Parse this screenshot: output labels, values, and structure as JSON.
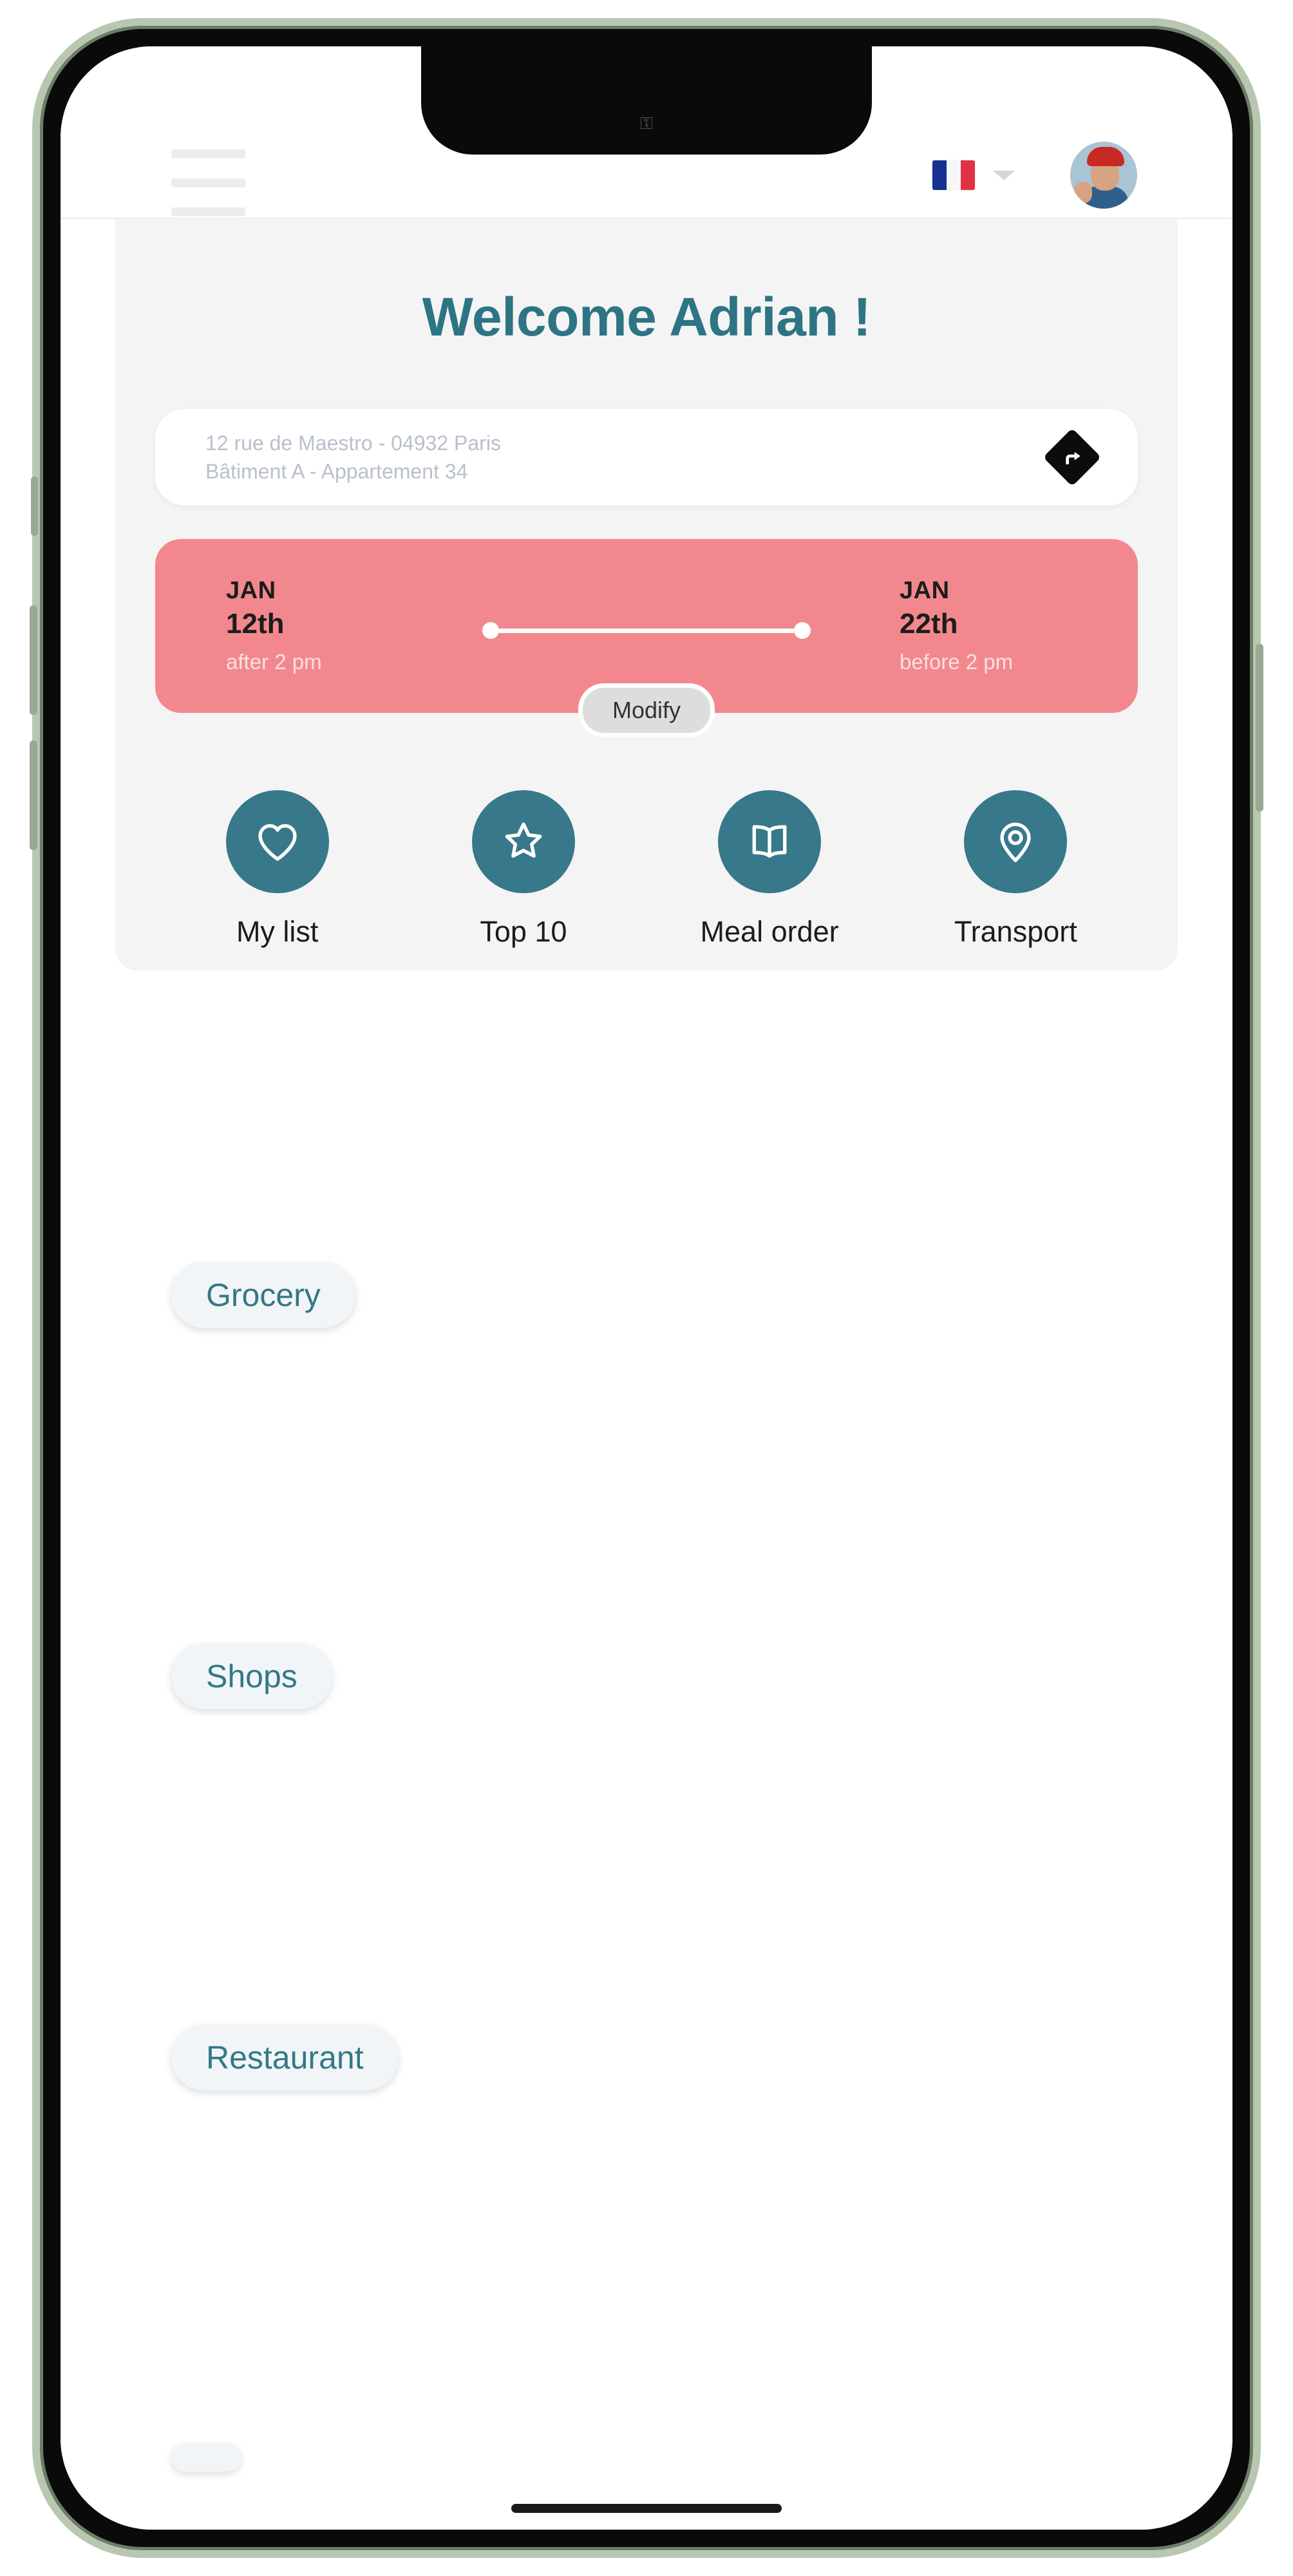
{
  "app": {
    "header": {
      "menu_icon": "hamburger-menu-icon",
      "language_flag": "france-flag-icon",
      "language_code": "FR",
      "chevron_icon": "chevron-down-icon",
      "avatar_icon": "user-avatar"
    },
    "status_bar": {
      "lock_icon": "lock-icon",
      "lock_glyph": "⚿"
    },
    "welcome_title": "Welcome Adrian !",
    "address": {
      "line1": "12 rue de Maestro - 04932 Paris",
      "line2": "Bâtiment A - Appartement 34",
      "directions_icon": "directions-arrow-icon"
    },
    "stay": {
      "start": {
        "month": "JAN",
        "day": "12th",
        "time": "after 2 pm"
      },
      "end": {
        "month": "JAN",
        "day": "22th",
        "time": "before 2 pm"
      },
      "modify_label": "Modify"
    },
    "quick_actions": [
      {
        "label": "My list",
        "icon": "heart-icon"
      },
      {
        "label": "Top 10",
        "icon": "star-icon"
      },
      {
        "label": "Meal order",
        "icon": "book-icon"
      },
      {
        "label": "Transport",
        "icon": "map-pin-icon"
      }
    ],
    "categories": [
      {
        "label": "Grocery",
        "image": "supermarket-produce-shelves"
      },
      {
        "label": "Shops",
        "image": "clothing-boutique-interior"
      },
      {
        "label": "Restaurant",
        "image": "fine-dining-plated-dish"
      },
      {
        "label": "",
        "image": "concert-crowd-purple-lights"
      }
    ],
    "colors": {
      "accent_teal": "#37788a",
      "title_teal": "#2d7584",
      "date_card_pink": "#f2888e",
      "panel_gray": "#f4f4f4",
      "pill_bg": "#f1f5f7",
      "pill_text": "#347886",
      "address_text": "#b9c0cc"
    }
  }
}
